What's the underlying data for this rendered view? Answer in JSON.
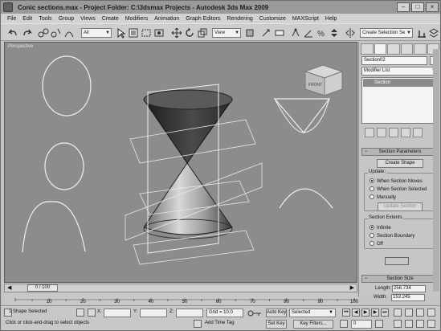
{
  "window": {
    "title": "Conic sections.max    - Project Folder: C:\\3dsmax Projects    - Autodesk 3ds Max  2009",
    "minimize": "–",
    "maximize": "□",
    "close": "×"
  },
  "menubar": {
    "items": [
      "File",
      "Edit",
      "Tools",
      "Group",
      "Views",
      "Create",
      "Modifiers",
      "Animation",
      "Graph Editors",
      "Rendering",
      "Customize",
      "MAXScript",
      "Help"
    ]
  },
  "toolbar": {
    "selection_filter": "All",
    "reference_coord": "View",
    "named_selection_placeholder": "Create Selection Se"
  },
  "viewport": {
    "label": "Perspective",
    "viewcube_label": "FRONT"
  },
  "command_panel": {
    "object_name": "Section02",
    "modifier_list": "Modifier List",
    "stack_selected": "Section",
    "section_parameters": "Section Parameters",
    "create_shape": "Create Shape",
    "update_label": "Update:",
    "update_options": [
      "When Section Moves",
      "When Section Selected",
      "Manually"
    ],
    "update_selected": 0,
    "update_section": "Update Section",
    "section_extents_label": "Section Extents",
    "extents_options": [
      "Infinite",
      "Section Boundary",
      "Off"
    ],
    "extents_selected": 0,
    "section_size": "Section Size",
    "length_label": "Length:",
    "length_value": "256.734",
    "width_label": "Width:",
    "width_value": "153.245",
    "colors": {
      "section_color": "#f4f4f4"
    }
  },
  "timeline": {
    "frame_display": "0 / 100",
    "ticks": [
      "0",
      "10",
      "20",
      "30",
      "40",
      "50",
      "60",
      "70",
      "80",
      "90",
      "100"
    ]
  },
  "statusbar": {
    "selection_status": "1 Shape Selected",
    "prompt": "Click or click-and-drag to select objects",
    "x_label": "X:",
    "y_label": "Y:",
    "z_label": "Z:",
    "grid": "Grid = 10.0",
    "add_time_tag": "Add Time Tag",
    "auto_key": "Auto Key",
    "set_key": "Set Key",
    "key_mode": "Selected",
    "key_filters": "Key Filters...",
    "current_frame": "0"
  }
}
